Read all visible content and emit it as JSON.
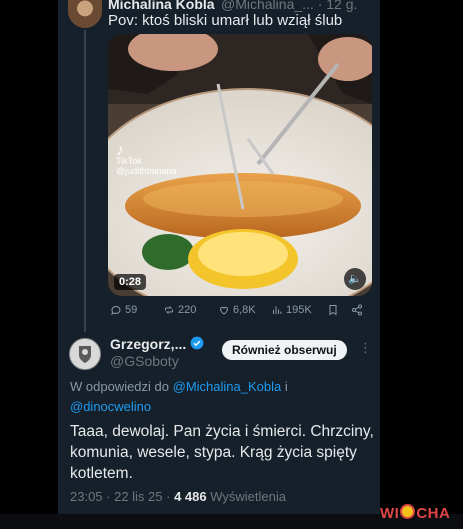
{
  "tweet": {
    "author_name": "Michalina Kobla",
    "author_handle": "@Michalina_...",
    "time_ago": "· 12 g.",
    "text": "Pov: ktoś bliski umarł lub wziął ślub",
    "media": {
      "watermark_brand": "TikTok",
      "watermark_user": "@judithbanana",
      "duration": "0:28"
    },
    "actions": {
      "replies": "59",
      "reposts": "220",
      "likes": "6,8K",
      "views": "195K"
    }
  },
  "reply": {
    "author_name": "Grzegorz,...",
    "author_handle": "@GSoboty",
    "follow_label": "Również obserwuj",
    "reply_prefix": "W odpowiedzi do",
    "mention_1": "@Michalina_Kobla",
    "joiner": "i",
    "mention_2": "@dinocwelino",
    "text": "Taaa, dewolaj. Pan życia i śmierci. Chrzciny, komunia, wesele, stypa. Krąg życia spięty kotletem.",
    "time": "23:05 · 22 lis 25 ·",
    "views_count": "4 486",
    "views_label": "Wyświetlenia"
  },
  "watermark": {
    "part1": "WI",
    "part2": "CHA"
  },
  "colors": {
    "panel_bg": "#15202b",
    "accent_blue": "#1d9bf0",
    "text": "#e7e9ea",
    "muted": "#71767b"
  }
}
